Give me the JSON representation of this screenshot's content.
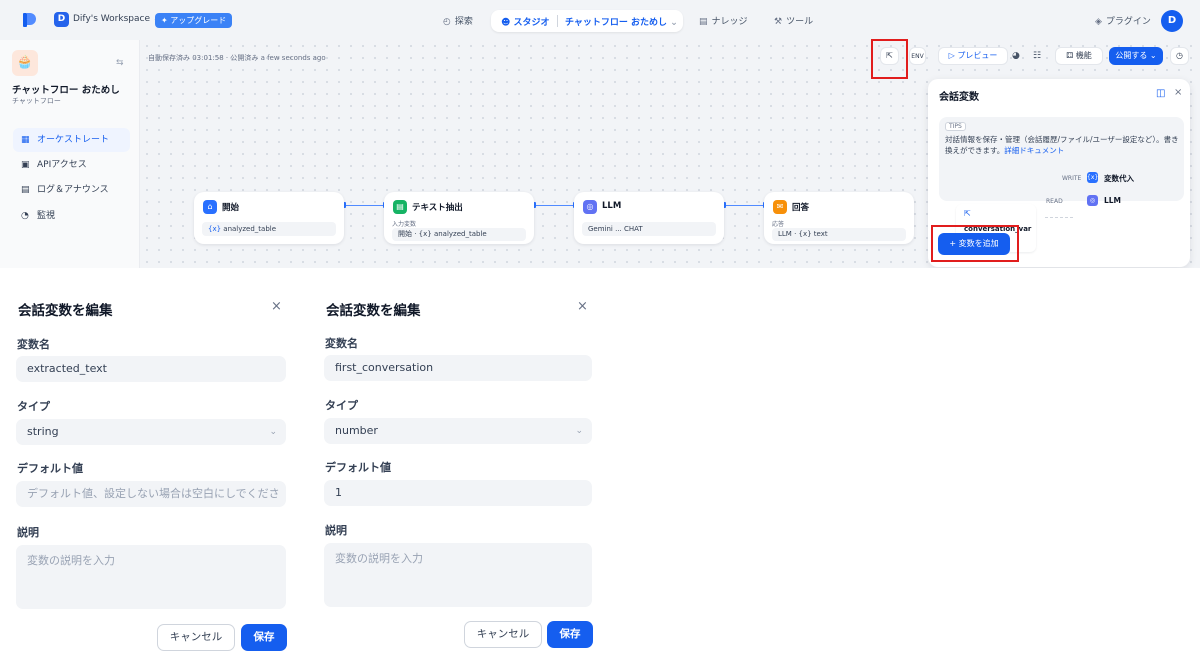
{
  "topnav": {
    "workspace_initial": "D",
    "workspace_name": "Dify's Workspace",
    "upgrade": "✦ アップグレード",
    "explore": "探索",
    "studio": "スタジオ",
    "app_name": "チャットフロー おためし",
    "knowledge": "ナレッジ",
    "tools": "ツール",
    "plugins": "プラグイン",
    "avatar": "D"
  },
  "sidebar": {
    "app_title": "チャットフロー おためし",
    "app_type": "チャットフロー",
    "items": [
      {
        "label": "オーケストレート",
        "icon": "orchestrate-icon"
      },
      {
        "label": "APIアクセス",
        "icon": "api-icon"
      },
      {
        "label": "ログ＆アナウンス",
        "icon": "log-icon"
      },
      {
        "label": "監視",
        "icon": "monitor-icon"
      }
    ]
  },
  "toolbar": {
    "autosave": "自動保存済み 03:01:58 · 公開済み a few seconds ago",
    "preview": "プレビュー",
    "features": "機能",
    "publish": "公開する"
  },
  "nodes": [
    {
      "title": "開始",
      "row": "{x} analyzed_table",
      "color": "#2970ff",
      "icon": "home-icon"
    },
    {
      "title": "テキスト抽出",
      "sublabel": "入力変数",
      "row": "開始 · {x} analyzed_table",
      "color": "#16b364",
      "icon": "doc-extract-icon"
    },
    {
      "title": "LLM",
      "row": "Gemini ...  CHAT",
      "color": "#6172f3",
      "icon": "llm-icon"
    },
    {
      "title": "回答",
      "sublabel": "応答",
      "row": "LLM · {x} text",
      "color": "#f79009",
      "icon": "answer-icon"
    }
  ],
  "conv_panel": {
    "title": "会話変数",
    "tips_tag": "TIPS",
    "tips_text": "対話情報を保存・管理（会話履歴/ファイル/ユーザー設定など）。書き換えができます。",
    "tips_link": "詳細ドキュメント",
    "var_name": "conversation_var",
    "var_type": "String",
    "write_label": "WRITE",
    "write_target": "変数代入",
    "read_label": "READ",
    "read_target": "LLM",
    "add_button": "+ 変数を追加"
  },
  "dialogs": [
    {
      "title": "会話変数を編集",
      "name_label": "変数名",
      "name_value": "extracted_text",
      "type_label": "タイプ",
      "type_value": "string",
      "default_label": "デフォルト値",
      "default_placeholder": "デフォルト値、設定しない場合は空白にしでくださ",
      "desc_label": "説明",
      "desc_placeholder": "変数の説明を入力",
      "cancel": "キャンセル",
      "save": "保存"
    },
    {
      "title": "会話変数を編集",
      "name_label": "変数名",
      "name_value": "first_conversation",
      "type_label": "タイプ",
      "type_value": "number",
      "default_label": "デフォルト値",
      "default_value": "1",
      "desc_label": "説明",
      "desc_placeholder": "変数の説明を入力",
      "cancel": "キャンセル",
      "save": "保存"
    }
  ],
  "colors": {
    "accent": "#155eef",
    "highlight": "#e11d1d"
  }
}
